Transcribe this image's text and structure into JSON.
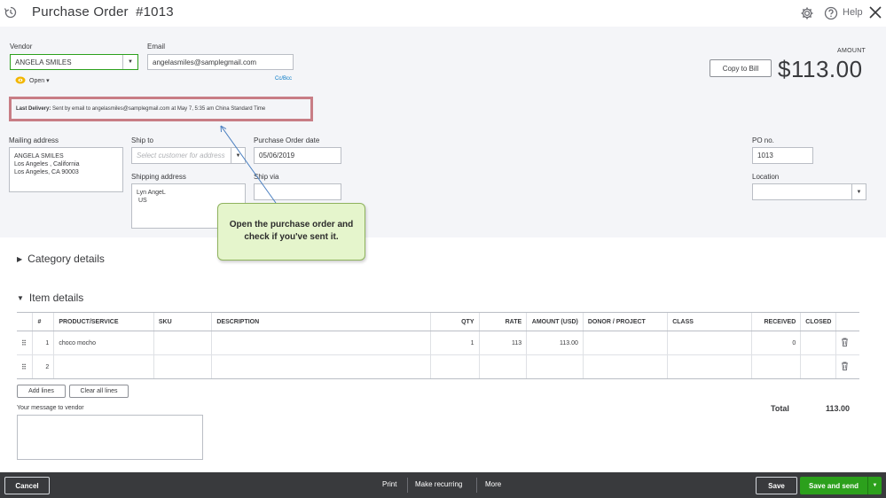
{
  "header": {
    "title": "Purchase Order",
    "number": "#1013",
    "help_label": "Help"
  },
  "vendor": {
    "label": "Vendor",
    "value": "ANGELA SMILES"
  },
  "email": {
    "label": "Email",
    "value": "angelasmiles@samplegmail.com",
    "ccbcc": "Cc/Bcc"
  },
  "status": {
    "label": "Open"
  },
  "amount": {
    "label": "AMOUNT",
    "value": "$113.00",
    "copy_button": "Copy to Bill"
  },
  "delivery": {
    "bold": "Last Delivery:",
    "text": "Sent by email to angelasmiles@samplegmail.com at May 7, 5:35 am China Standard Time"
  },
  "mailing": {
    "label": "Mailing address",
    "lines": [
      "ANGELA SMILES",
      "Los Angeles , California",
      "Los Angeles, CA  90003"
    ]
  },
  "ship_to": {
    "label": "Ship to",
    "placeholder": "Select customer for address"
  },
  "shipping_address": {
    "label": "Shipping address",
    "lines": [
      "Lyn AngeL",
      " US"
    ]
  },
  "po_date": {
    "label": "Purchase Order date",
    "value": "05/06/2019"
  },
  "ship_via": {
    "label": "Ship via",
    "value": ""
  },
  "po_no": {
    "label": "PO no.",
    "value": "1013"
  },
  "location": {
    "label": "Location",
    "value": ""
  },
  "tooltip": {
    "line1": "Open the purchase order and",
    "line2": "check if you've sent it."
  },
  "sections": {
    "category": "Category details",
    "item": "Item details"
  },
  "table": {
    "headers": [
      "#",
      "PRODUCT/SERVICE",
      "SKU",
      "DESCRIPTION",
      "QTY",
      "RATE",
      "AMOUNT (USD)",
      "DONOR / PROJECT",
      "CLASS",
      "RECEIVED",
      "CLOSED"
    ],
    "rows": [
      {
        "n": "1",
        "product": "choco mocho",
        "sku": "",
        "desc": "",
        "qty": "1",
        "rate": "113",
        "amount": "113.00",
        "donor": "",
        "class": "",
        "received": "0"
      },
      {
        "n": "2",
        "product": "",
        "sku": "",
        "desc": "",
        "qty": "",
        "rate": "",
        "amount": "",
        "donor": "",
        "class": "",
        "received": ""
      }
    ]
  },
  "buttons": {
    "add_lines": "Add lines",
    "clear_lines": "Clear all lines"
  },
  "message": {
    "label": "Your message to vendor"
  },
  "total": {
    "label": "Total",
    "value": "113.00"
  },
  "footer": {
    "cancel": "Cancel",
    "print": "Print",
    "make_recurring": "Make recurring",
    "more": "More",
    "save": "Save",
    "save_and_send": "Save and send"
  },
  "colors": {
    "accent_green": "#2ca01c",
    "footer_bg": "#393a3d",
    "highlight_border": "#c87d85",
    "tooltip_bg": "#e5f5cc"
  },
  "icons": [
    "history-icon",
    "gear-icon",
    "help-icon",
    "close-icon",
    "open-status-icon",
    "chevron-down-icon",
    "drag-handle-icon",
    "trash-icon"
  ]
}
